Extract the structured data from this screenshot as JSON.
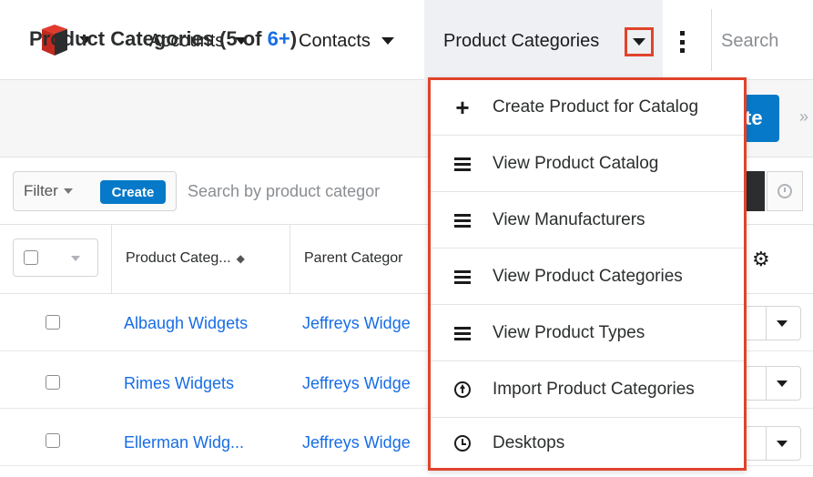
{
  "topnav": {
    "items": [
      {
        "label": "Accounts"
      },
      {
        "label": "Contacts"
      },
      {
        "label": "Product Categories"
      }
    ],
    "search_placeholder": "Search"
  },
  "subheader": {
    "title_prefix": "Product Categories (5 of ",
    "title_count_link": "6+",
    "title_suffix": ")",
    "create_label": "te"
  },
  "filter": {
    "filter_label": "Filter",
    "create_label": "Create",
    "search_placeholder": "Search by product categor"
  },
  "table": {
    "columns": [
      "Product Categ...",
      "Parent Categor"
    ],
    "rows": [
      {
        "name": "Albaugh Widgets",
        "parent": "Jeffreys Widge"
      },
      {
        "name": "Rimes Widgets",
        "parent": "Jeffreys Widge"
      },
      {
        "name": "Ellerman Widg...",
        "parent": "Jeffreys Widge"
      }
    ]
  },
  "dropdown": {
    "items": [
      {
        "label": "Create Product for Catalog",
        "icon": "plus-icon"
      },
      {
        "label": "View Product Catalog",
        "icon": "list-icon"
      },
      {
        "label": "View Manufacturers",
        "icon": "list-icon"
      },
      {
        "label": "View Product Categories",
        "icon": "list-icon"
      },
      {
        "label": "View Product Types",
        "icon": "list-icon"
      },
      {
        "label": "Import Product Categories",
        "icon": "upload-circle-icon"
      },
      {
        "label": "Desktops",
        "icon": "clock-icon"
      }
    ]
  },
  "colors": {
    "brand_blue": "#0679c8",
    "link_blue": "#176de5",
    "highlight_red": "#e0432b"
  }
}
